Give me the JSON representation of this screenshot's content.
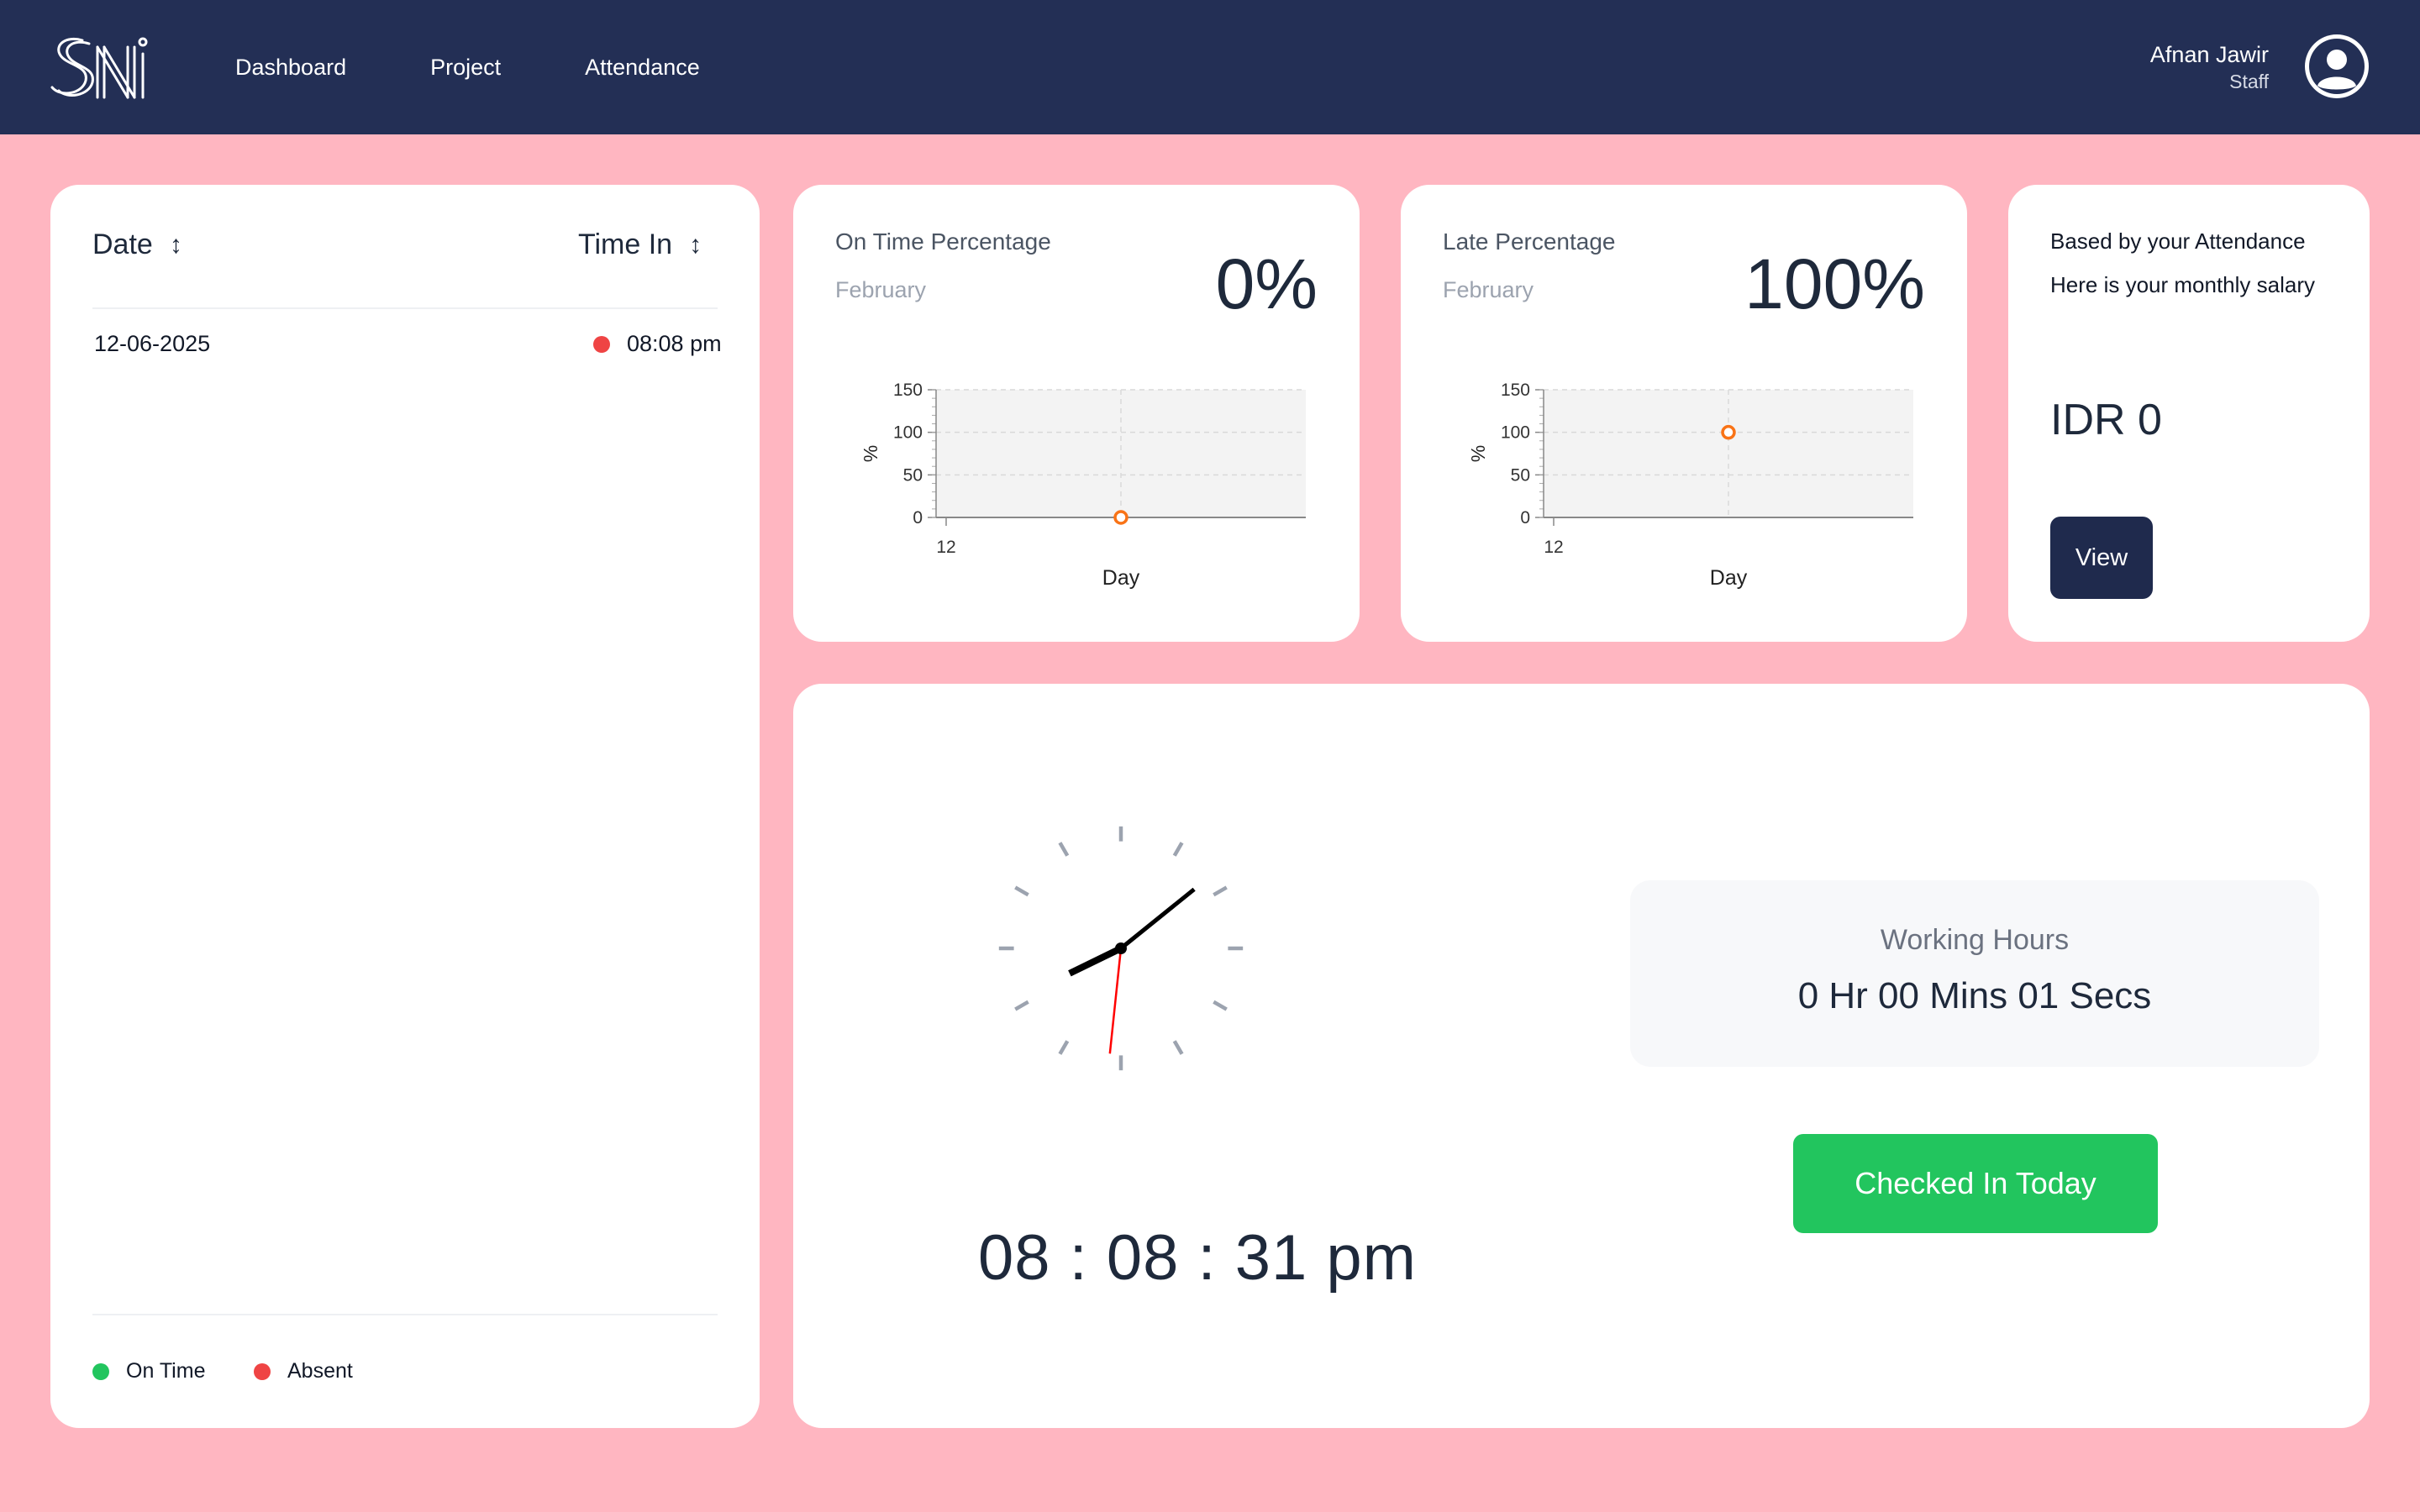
{
  "navbar": {
    "links": [
      "Dashboard",
      "Project",
      "Attendance"
    ],
    "user_name": "Afnan Jawir",
    "user_role": "Staff"
  },
  "attendance_table": {
    "columns": [
      "Date",
      "Time In"
    ],
    "rows": [
      {
        "date": "12-06-2025",
        "time_in": "08:08 pm",
        "status": "Absent"
      }
    ],
    "legend": [
      {
        "label": "On Time",
        "color": "#22c55e"
      },
      {
        "label": "Absent",
        "color": "#ef4444"
      }
    ]
  },
  "on_time_card": {
    "title": "On Time Percentage",
    "month": "February",
    "value": "0%"
  },
  "late_card": {
    "title": "Late Percentage",
    "month": "February",
    "value": "100%"
  },
  "salary_card": {
    "line1": "Based by your Attendance",
    "line2": "Here is your monthly salary",
    "value": "IDR 0",
    "button": "View"
  },
  "clock": {
    "time": "08 : 08 : 31 pm",
    "hour": 8,
    "minute": 8,
    "second": 31
  },
  "working_hours": {
    "title": "Working Hours",
    "value": "0 Hr 00 Mins 01 Secs"
  },
  "checkin_button": "Checked In Today",
  "colors": {
    "navbar": "#232F55",
    "background": "#FFB6C1",
    "accent_green": "#22c55e",
    "accent_red": "#ef4444",
    "marker_orange": "#f97316"
  },
  "chart_data": [
    {
      "type": "scatter",
      "title": "",
      "xlabel": "Day",
      "ylabel": "%",
      "x_ticks": [
        "12"
      ],
      "y_ticks": [
        0,
        50,
        100,
        150
      ],
      "ylim": [
        0,
        150
      ],
      "grid": true,
      "series": [
        {
          "x": [
            12
          ],
          "y": [
            0
          ]
        }
      ]
    },
    {
      "type": "scatter",
      "title": "",
      "xlabel": "Day",
      "ylabel": "%",
      "x_ticks": [
        "12"
      ],
      "y_ticks": [
        0,
        50,
        100,
        150
      ],
      "ylim": [
        0,
        150
      ],
      "grid": true,
      "series": [
        {
          "x": [
            12
          ],
          "y": [
            100
          ]
        }
      ]
    }
  ]
}
